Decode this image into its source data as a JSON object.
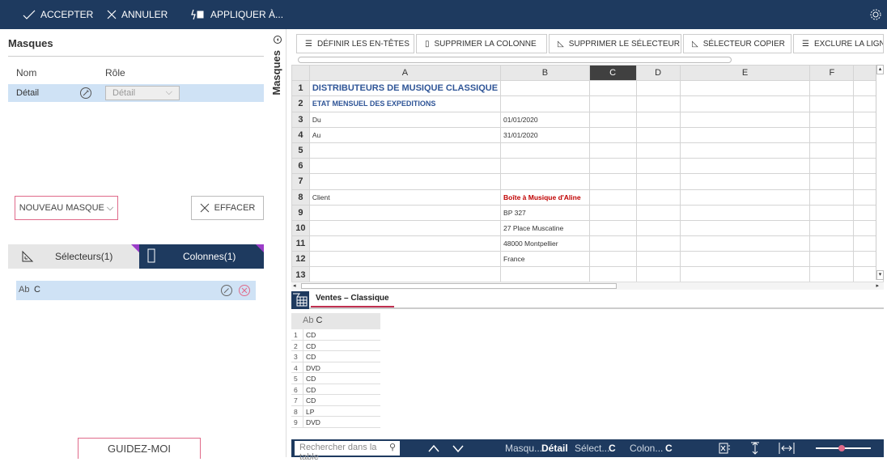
{
  "toolbar": {
    "accept": "ACCEPTER",
    "cancel": "ANNULER",
    "apply": "APPLIQUER À..."
  },
  "left": {
    "title": "Masques",
    "col_name": "Nom",
    "col_role": "Rôle",
    "mask_name": "Détail",
    "mask_role": "Détail",
    "new_mask": "NOUVEAU MASQUE ⌵",
    "clear": "EFFACER",
    "tab_selectors": "Sélecteurs(1)",
    "tab_columns": "Colonnes(1)",
    "column_type": "Ab",
    "column_name": "C",
    "guide": "GUIDEZ-MOI"
  },
  "side_tab": "Masques",
  "ribbon": {
    "define_headers": "DÉFINIR LES EN-TÊTES",
    "delete_column": "SUPPRIMER LA COLONNE",
    "delete_selector": "SUPPRIMER LE SÉLECTEUR",
    "copy_selector": "SÉLECTEUR COPIER",
    "exclude_line": "EXCLURE LA LIGNE"
  },
  "sheet": {
    "columns": [
      "A",
      "B",
      "C",
      "D",
      "E",
      "F"
    ],
    "selected_column": "C",
    "rows": [
      {
        "n": "1",
        "a": "DISTRIBUTEURS DE MUSIQUE CLASSIQUE",
        "b": ""
      },
      {
        "n": "2",
        "a": "ETAT MENSUEL DES EXPEDITIONS",
        "b": ""
      },
      {
        "n": "3",
        "a": "Du",
        "b": "01/01/2020"
      },
      {
        "n": "4",
        "a": "Au",
        "b": "31/01/2020"
      },
      {
        "n": "5",
        "a": "",
        "b": ""
      },
      {
        "n": "6",
        "a": "",
        "b": ""
      },
      {
        "n": "7",
        "a": "",
        "b": ""
      },
      {
        "n": "8",
        "a": "Client",
        "b": "Boîte à Musique d'Aline"
      },
      {
        "n": "9",
        "a": "",
        "b": "BP 327"
      },
      {
        "n": "10",
        "a": "",
        "b": "27 Place Muscatine"
      },
      {
        "n": "11",
        "a": "",
        "b": "48000 Montpellier"
      },
      {
        "n": "12",
        "a": "",
        "b": "France"
      },
      {
        "n": "13",
        "a": "",
        "b": ""
      }
    ],
    "tab_name": "Ventes – Classique"
  },
  "preview": {
    "header_type": "Ab",
    "header_name": "C",
    "rows": [
      {
        "n": "1",
        "v": "CD"
      },
      {
        "n": "2",
        "v": "CD"
      },
      {
        "n": "3",
        "v": "CD"
      },
      {
        "n": "4",
        "v": "DVD"
      },
      {
        "n": "5",
        "v": "CD"
      },
      {
        "n": "6",
        "v": "CD"
      },
      {
        "n": "7",
        "v": "CD"
      },
      {
        "n": "8",
        "v": "LP"
      },
      {
        "n": "9",
        "v": "DVD"
      }
    ]
  },
  "status": {
    "search_placeholder": "Rechercher dans la table",
    "mask_label": "Masqu...",
    "mask_value": "Détail",
    "selector_label": "Sélect...",
    "selector_value": "C",
    "column_label": "Colon...",
    "column_value": "C"
  },
  "colors": {
    "navy": "#1e3a5f",
    "selection": "#cfe2f5",
    "accent_pink": "#e06a8a",
    "accent_purple": "#9b3dc8",
    "title_blue": "#2f5597",
    "red_text": "#c00000"
  }
}
